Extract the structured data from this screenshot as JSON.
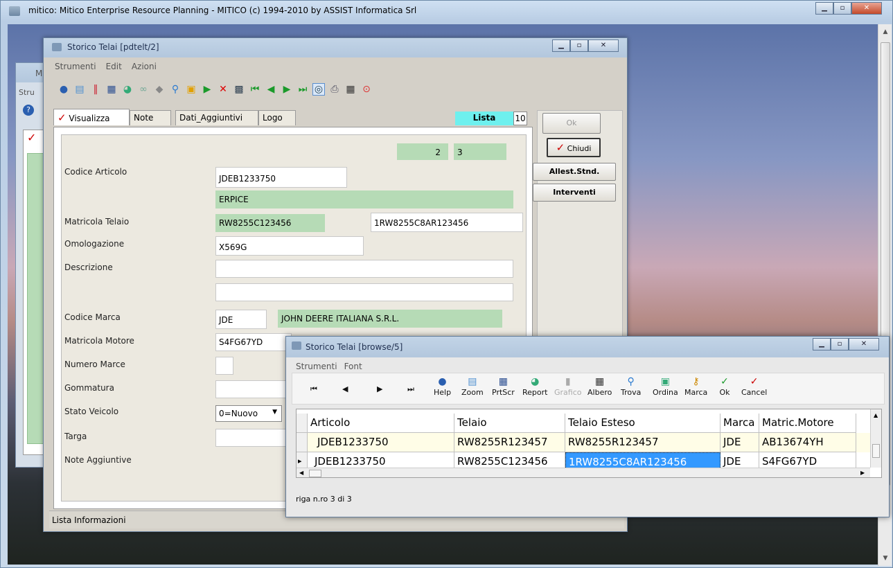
{
  "main": {
    "title": "mitico: Mitico Enterprise Resource Planning - MITICO (c) 1994-2010 by ASSIST Informatica Srl"
  },
  "back_window": {
    "menu_fragment": "Stru",
    "title_fragment": "M"
  },
  "storico": {
    "title": "Storico Telai [pdtelt/2]",
    "menu": [
      "Strumenti",
      "Edit",
      "Azioni"
    ],
    "tabs": [
      "Visualizza",
      "Note",
      "Dati_Aggiuntivi",
      "Logo"
    ],
    "lista_label": "Lista",
    "lista_count": "10",
    "counter_a": "2",
    "counter_b": "3",
    "buttons": {
      "ok": "Ok",
      "chiudi": "Chiudi",
      "allest": "Allest.Stnd.",
      "interventi": "Interventi"
    },
    "labels": {
      "codice_articolo": "Codice Articolo",
      "matricola_telaio": "Matricola Telaio",
      "omologazione": "Omologazione",
      "descrizione": "Descrizione",
      "codice_marca": "Codice Marca",
      "matricola_motore": "Matricola Motore",
      "numero_marce": "Numero Marce",
      "gommatura": "Gommatura",
      "stato_veicolo": "Stato Veicolo",
      "targa": "Targa",
      "note_aggiuntive": "Note Aggiuntive"
    },
    "values": {
      "codice_articolo": "JDEB1233750",
      "articolo_desc": "ERPICE",
      "matricola_telaio": "RW8255C123456",
      "telaio_esteso": "1RW8255C8AR123456",
      "omologazione": "X569G",
      "codice_marca": "JDE",
      "marca_desc": "JOHN DEERE ITALIANA S.R.L.",
      "matricola_motore": "S4FG67YD",
      "stato_veicolo": "0=Nuovo"
    },
    "status": "Lista Informazioni"
  },
  "browse": {
    "title": "Storico Telai [browse/5]",
    "menu": [
      "Strumenti",
      "Font"
    ],
    "toolbar": [
      "Help",
      "Zoom",
      "PrtScr",
      "Report",
      "Grafico",
      "Albero",
      "Trova",
      "Ordina",
      "Marca",
      "Ok",
      "Cancel"
    ],
    "columns": [
      "Articolo",
      "Telaio",
      "Telaio Esteso",
      "Marca",
      "Matric.Motore"
    ],
    "rows": [
      [
        "JDEB1233750",
        "RW8255R123457",
        "RW8255R123457",
        "JDE",
        "AB13674YH"
      ],
      [
        "JDEB1233750",
        "RW8255C123456",
        "1RW8255C8AR123456",
        "JDE",
        "S4FG67YD"
      ]
    ],
    "footer": "riga n.ro 3 di 3"
  },
  "colors": {
    "field_green": "#b6dbb6",
    "selection_blue": "#3399ff",
    "row_yellow": "#fffde7"
  }
}
